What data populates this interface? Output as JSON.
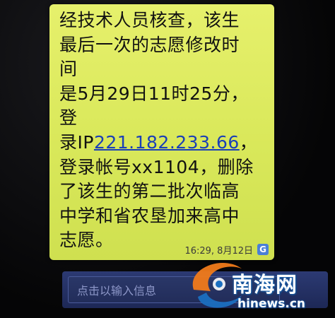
{
  "message": {
    "lines": [
      "经技术人员核查，该生",
      "最后一次的志愿修改时",
      "间",
      "是5月29日11时25分，",
      "登",
      "录IP",
      "登录帐号xx1104，删除",
      "了该生的第二批次临高",
      "中学和省农垦加来高中",
      "志愿。"
    ],
    "ip_link": "221.182.233.66",
    "ip_suffix": "，",
    "timestamp": "16:29, 8月12日",
    "badge": "G"
  },
  "input": {
    "placeholder": "点击以输入信息"
  },
  "watermark": {
    "name": "南海网",
    "domain": "hinews.cn"
  },
  "colors": {
    "bubble": "#dbe95c",
    "link": "#1a3fb8",
    "input_bar": "#26326a",
    "watermark_orange": "#f07a1a",
    "watermark_blue": "#1b6fc0"
  },
  "icons": {
    "badge": "g-badge-icon",
    "watermark_logo": "swirl-logo-icon"
  }
}
